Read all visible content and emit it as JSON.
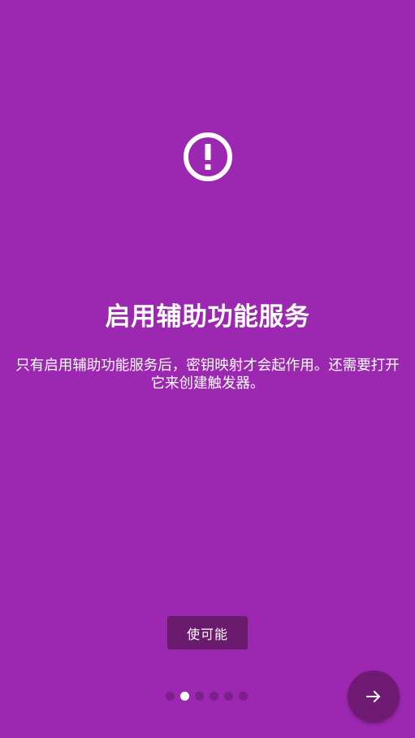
{
  "colors": {
    "background": "#9c27b0",
    "button": "#6a1b6e",
    "fab": "#6e1a72",
    "dot_active": "#ffffff",
    "dot_inactive": "#7d1f8c"
  },
  "icon": {
    "name": "alert-circle-icon"
  },
  "slide": {
    "title": "启用辅助功能服务",
    "description": "只有启用辅助功能服务后，密钥映射才会起作用。还需要打开它来创建触发器。",
    "enable_label": "使可能"
  },
  "pager": {
    "page_count": 6,
    "current_page": 2
  },
  "next_button": {
    "icon": "arrow-right-icon"
  }
}
